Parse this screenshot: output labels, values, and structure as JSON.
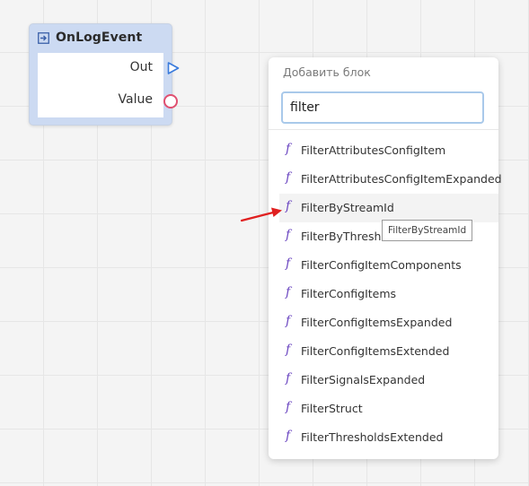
{
  "node": {
    "title": "OnLogEvent",
    "icon": "entry-icon",
    "ports": {
      "out_label": "Out",
      "value_label": "Value"
    },
    "colors": {
      "header": "#ccdaf2",
      "value_port": "#e05070",
      "out_port": "#3a7bdc"
    }
  },
  "popup": {
    "title": "Добавить блок",
    "search": {
      "value": "filter"
    },
    "items": [
      {
        "icon": "function-icon",
        "label": "FilterAttributesConfigItem"
      },
      {
        "icon": "function-icon",
        "label": "FilterAttributesConfigItemExpanded"
      },
      {
        "icon": "function-icon",
        "label": "FilterByStreamId"
      },
      {
        "icon": "function-icon",
        "label": "FilterByThresholdsExt"
      },
      {
        "icon": "function-icon",
        "label": "FilterConfigItemComponents"
      },
      {
        "icon": "function-icon",
        "label": "FilterConfigItems"
      },
      {
        "icon": "function-icon",
        "label": "FilterConfigItemsExpanded"
      },
      {
        "icon": "function-icon",
        "label": "FilterConfigItemsExtended"
      },
      {
        "icon": "function-icon",
        "label": "FilterSignalsExpanded"
      },
      {
        "icon": "function-icon",
        "label": "FilterStruct"
      },
      {
        "icon": "function-icon",
        "label": "FilterThresholdsExtended"
      }
    ],
    "hovered_index": 2,
    "function_glyph": "f"
  },
  "tooltip": {
    "text": "FilterByStreamId"
  },
  "annotation": {
    "arrow_color": "#e02020"
  }
}
